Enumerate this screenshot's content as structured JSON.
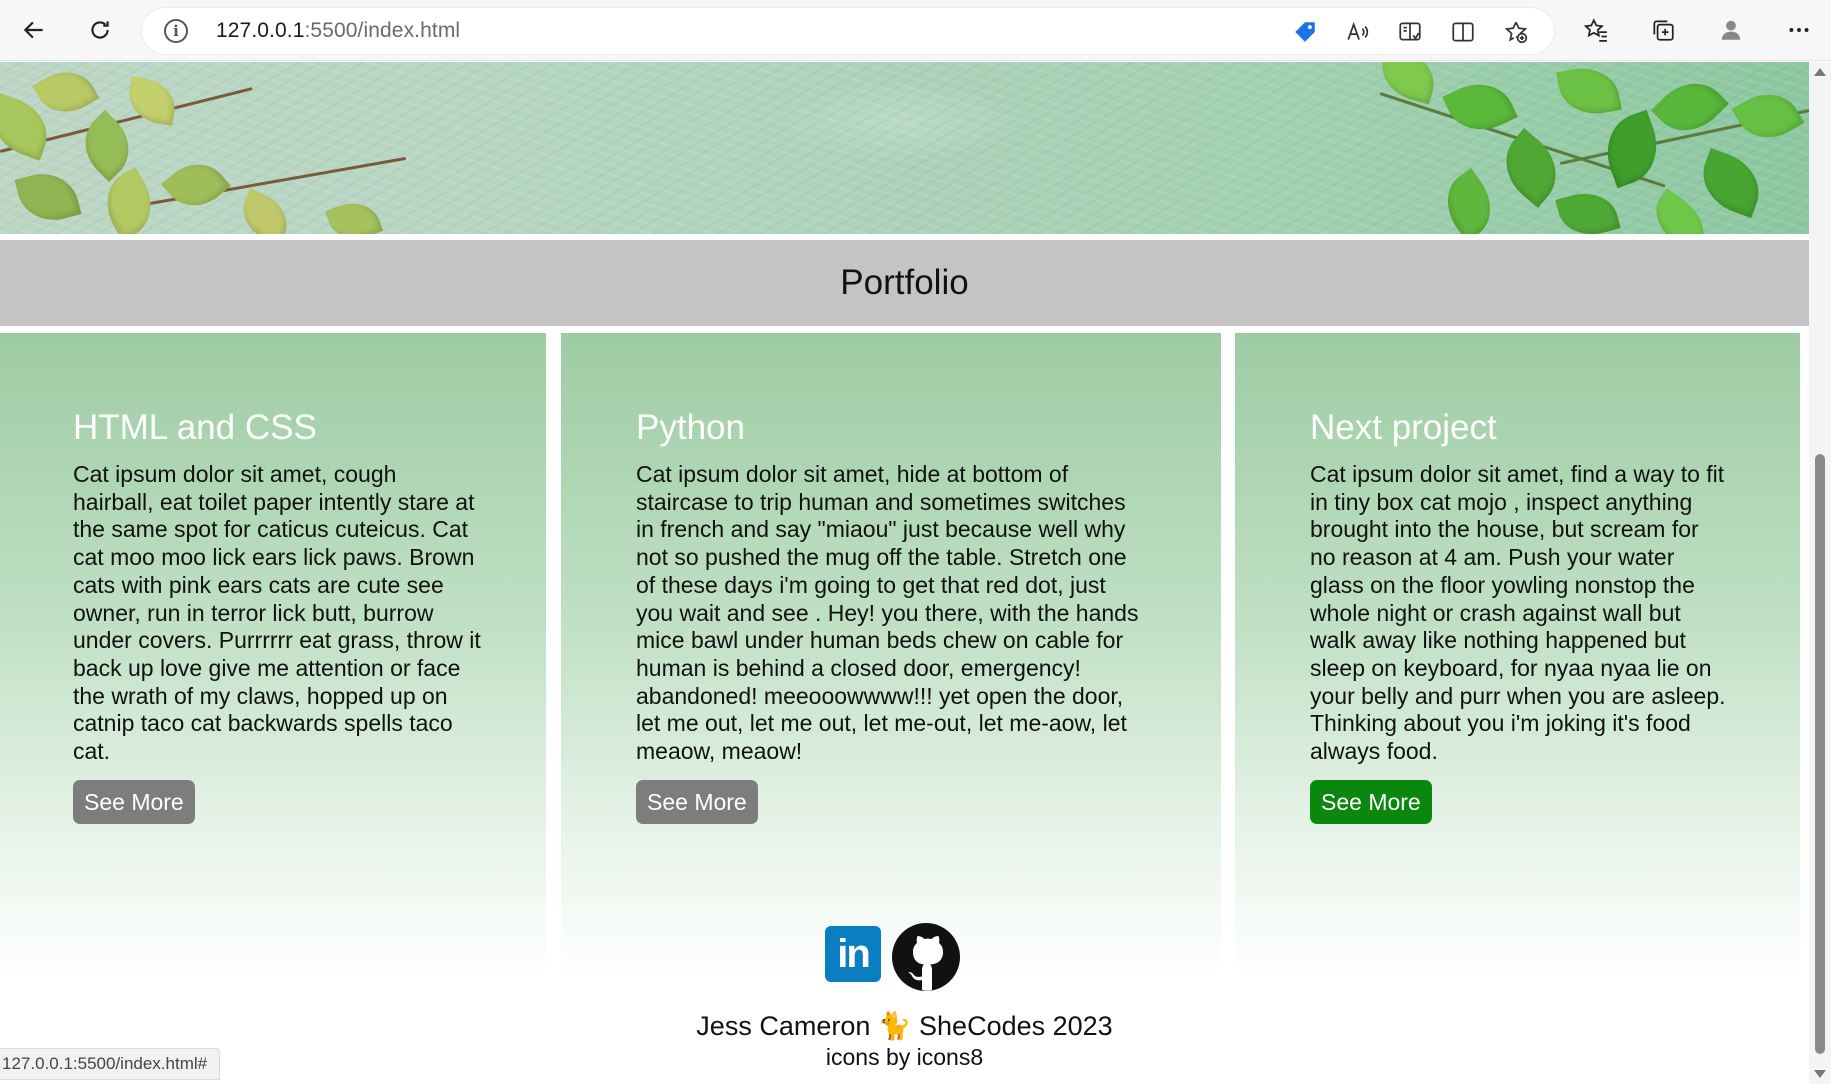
{
  "browser": {
    "url_host": "127.0.0.1",
    "url_rest": ":5500/index.html",
    "status_url": "127.0.0.1:5500/index.html#"
  },
  "heading": {
    "title": "Portfolio"
  },
  "projects": [
    {
      "title": "HTML and CSS",
      "text": "Cat ipsum dolor sit amet, cough hairball, eat toilet paper intently stare at the same spot for caticus cuteicus. Cat cat moo moo lick ears lick paws. Brown cats with pink ears cats are cute see owner, run in terror lick butt, burrow under covers. Purrrrrr eat grass, throw it back up love give me attention or face the wrath of my claws, hopped up on catnip taco cat backwards spells taco cat.",
      "button": "See More"
    },
    {
      "title": "Python",
      "text": "Cat ipsum dolor sit amet, hide at bottom of staircase to trip human and sometimes switches in french and say \"miaou\" just because well why not so pushed the mug off the table. Stretch one of these days i'm going to get that red dot, just you wait and see . Hey! you there, with the hands mice bawl under human beds chew on cable for human is behind a closed door, emergency! abandoned! meeooowwww!!! yet open the door, let me out, let me out, let me-out, let me-aow, let meaow, meaow!",
      "button": "See More"
    },
    {
      "title": "Next project",
      "text": "Cat ipsum dolor sit amet, find a way to fit in tiny box cat mojo , inspect anything brought into the house, but scream for no reason at 4 am. Push your water glass on the floor yowling nonstop the whole night or crash against wall but walk away like nothing happened but sleep on keyboard, for nyaa nyaa lie on your belly and purr when you are asleep. Thinking about you i'm joking it's food always food.",
      "button": "See More"
    }
  ],
  "footer": {
    "linkedin_label": "in",
    "author": "Jess Cameron",
    "cat_emoji": "🐈",
    "org": "SheCodes 2023",
    "credit": "icons by icons8"
  },
  "colors": {
    "heading_bar": "#c4c4c4",
    "card_top": "#9dcca3",
    "button_gray": "#7d7d7d",
    "button_green": "#0a870f",
    "linkedin": "#0a7ec1"
  },
  "icons": [
    "back-arrow-icon",
    "refresh-icon",
    "info-icon",
    "tag-icon",
    "read-aloud-icon",
    "immersive-reader-icon",
    "split-screen-icon",
    "add-favorite-icon",
    "favorites-icon",
    "collections-icon",
    "profile-icon",
    "more-icon",
    "linkedin-icon",
    "github-icon"
  ]
}
